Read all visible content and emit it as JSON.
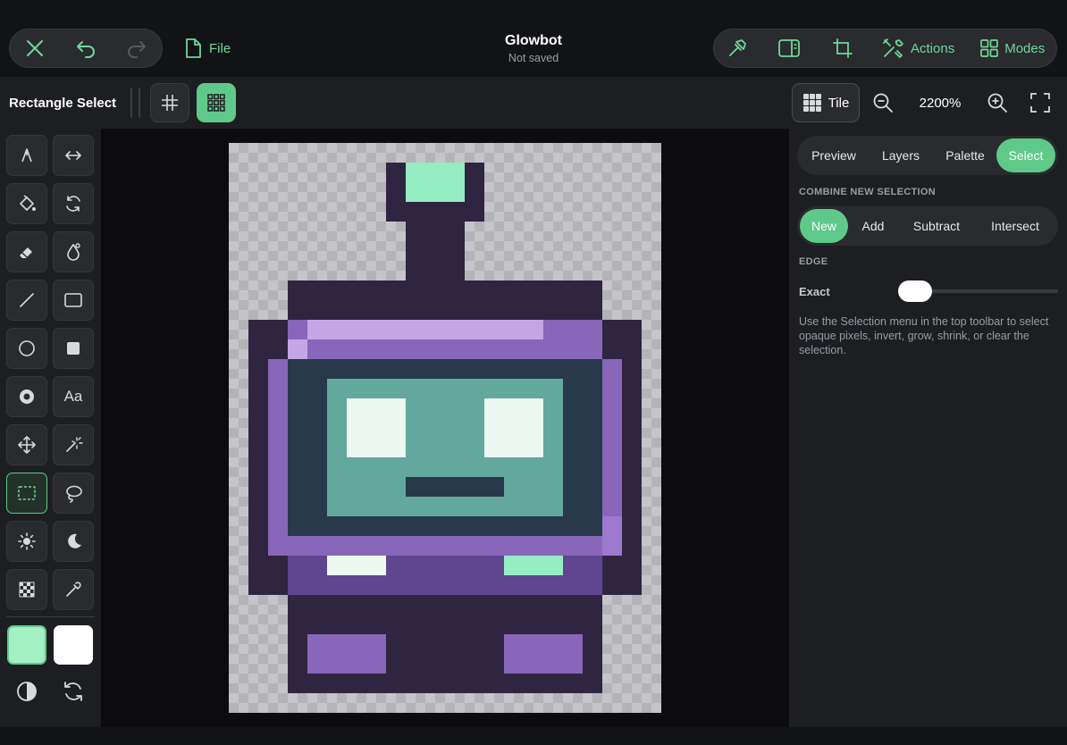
{
  "header": {
    "file_label": "File",
    "doc_title": "Glowbot",
    "doc_status": "Not saved",
    "actions_label": "Actions",
    "modes_label": "Modes"
  },
  "toolbar": {
    "tool_name": "Rectangle Select",
    "tile_label": "Tile",
    "zoom": "2200%"
  },
  "tools": {
    "text_tool_label": "Aa"
  },
  "colors": {
    "accent": "#5fc98a",
    "primary_swatch": "#a3f0c4",
    "secondary_swatch": "#ffffff"
  },
  "panel": {
    "tabs": [
      "Preview",
      "Layers",
      "Palette",
      "Select"
    ],
    "active_tab": "Select",
    "combine_heading": "COMBINE NEW SELECTION",
    "combine_options": [
      "New",
      "Add",
      "Subtract",
      "Intersect"
    ],
    "active_combine": "New",
    "edge_heading": "EDGE",
    "edge_label": "Exact",
    "edge_value": 0,
    "help_text": "Use the Selection menu in the top toolbar to select opaque pixels, invert, grow, shrink, or clear the selection."
  }
}
